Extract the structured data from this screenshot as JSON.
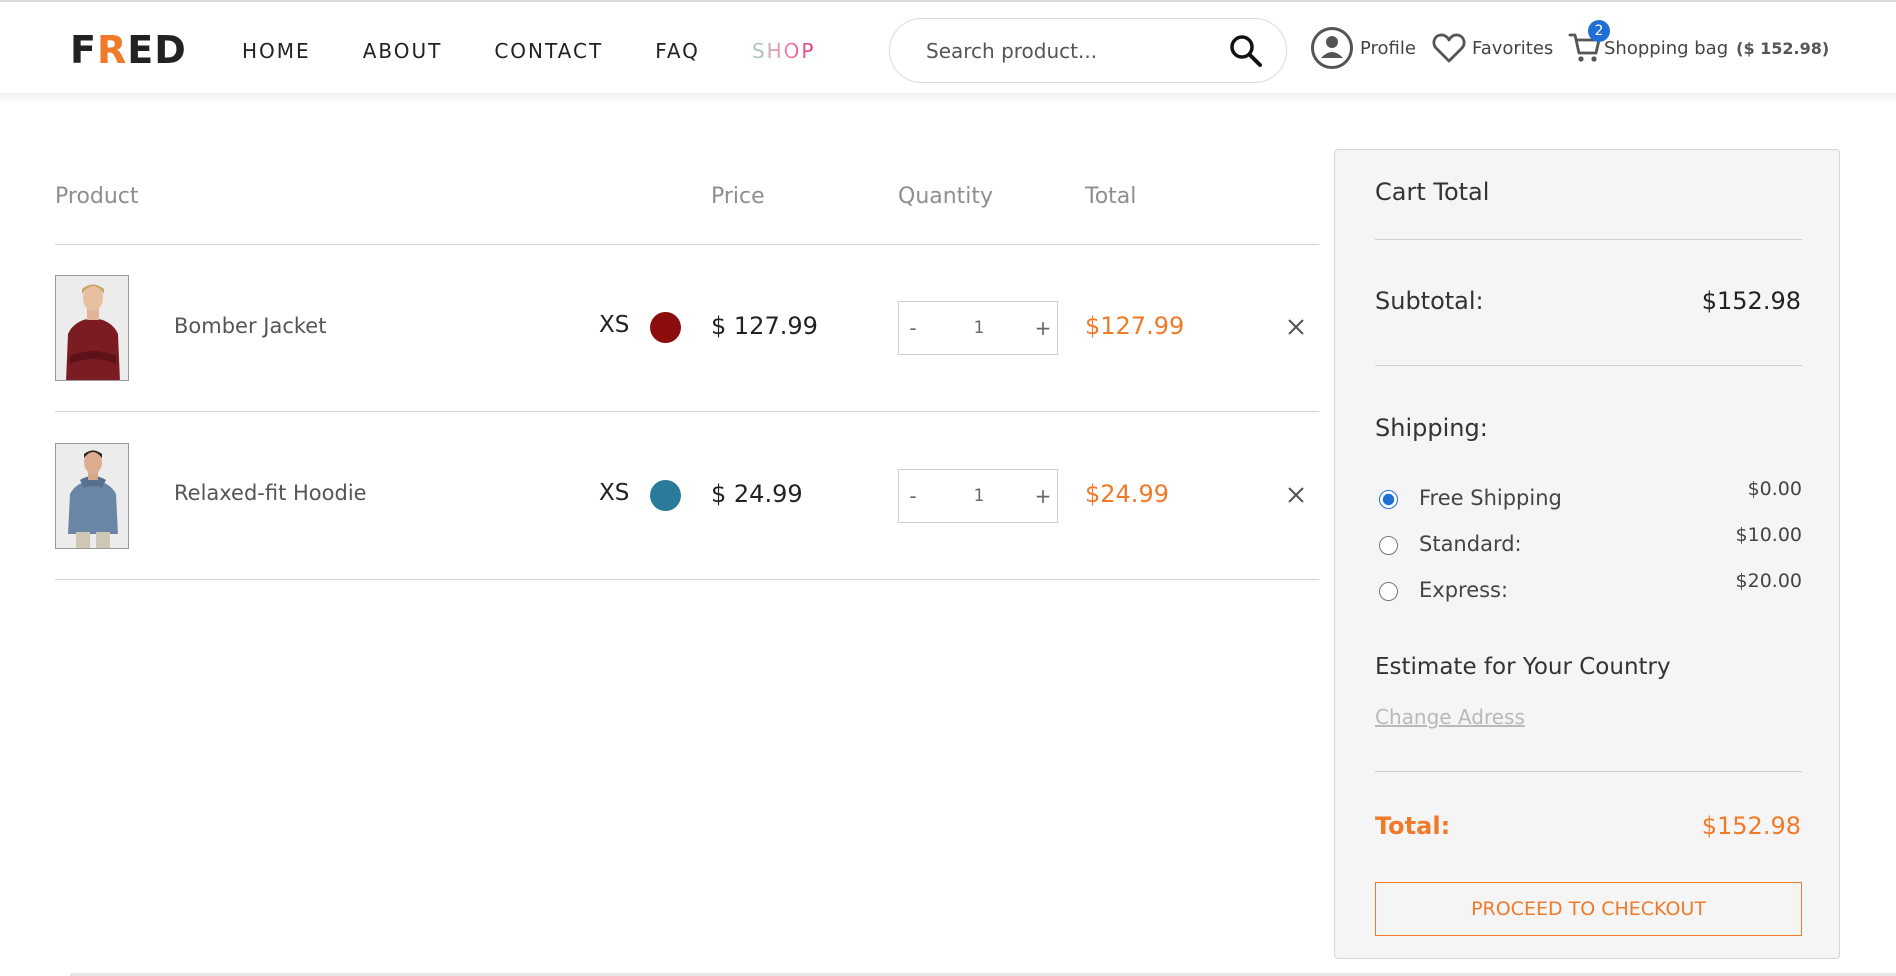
{
  "header": {
    "logo": {
      "before": "F",
      "accent": "R",
      "after": "ED"
    },
    "nav": [
      "HOME",
      "ABOUT",
      "CONTACT",
      "FAQ",
      "SHOP"
    ],
    "search": {
      "placeholder": "Search product..."
    },
    "profile_label": "Profile",
    "favorites_label": "Favorites",
    "bag_label": "Shopping bag",
    "bag_amount": "($ 152.98)",
    "bag_count": "2"
  },
  "table": {
    "headers": {
      "product": "Product",
      "price": "Price",
      "quantity": "Quantity",
      "total": "Total"
    },
    "rows": [
      {
        "name": "Bomber Jacket",
        "size": "XS",
        "color": "#8b0d0d",
        "price": "$ 127.99",
        "qty_minus": "-",
        "qty": "1",
        "qty_plus": "+",
        "total": "$127.99"
      },
      {
        "name": "Relaxed-fit Hoodie",
        "size": "XS",
        "color": "#2a7a9a",
        "price": "$ 24.99",
        "qty_minus": "-",
        "qty": "1",
        "qty_plus": "+",
        "total": "$24.99"
      }
    ]
  },
  "cart_total": {
    "title": "Cart Total",
    "subtotal_label": "Subtotal:",
    "subtotal_value": "$152.98",
    "shipping_label": "Shipping:",
    "shipping_options": [
      {
        "label": "Free Shipping",
        "price": "$0.00",
        "selected": true
      },
      {
        "label": "Standard:",
        "price": "$10.00",
        "selected": false
      },
      {
        "label": "Express:",
        "price": "$20.00",
        "selected": false
      }
    ],
    "estimate_title": "Estimate for Your Country",
    "change_address": "Change Adress",
    "total_label": "Total:",
    "total_value": "$152.98",
    "checkout_label": "PROCEED TO CHECKOUT"
  },
  "colors": {
    "accent": "#ef7a2a",
    "radio": "#1f6fd6"
  },
  "icons": [
    "search-icon",
    "profile-icon",
    "heart-icon",
    "cart-icon",
    "close-icon"
  ]
}
